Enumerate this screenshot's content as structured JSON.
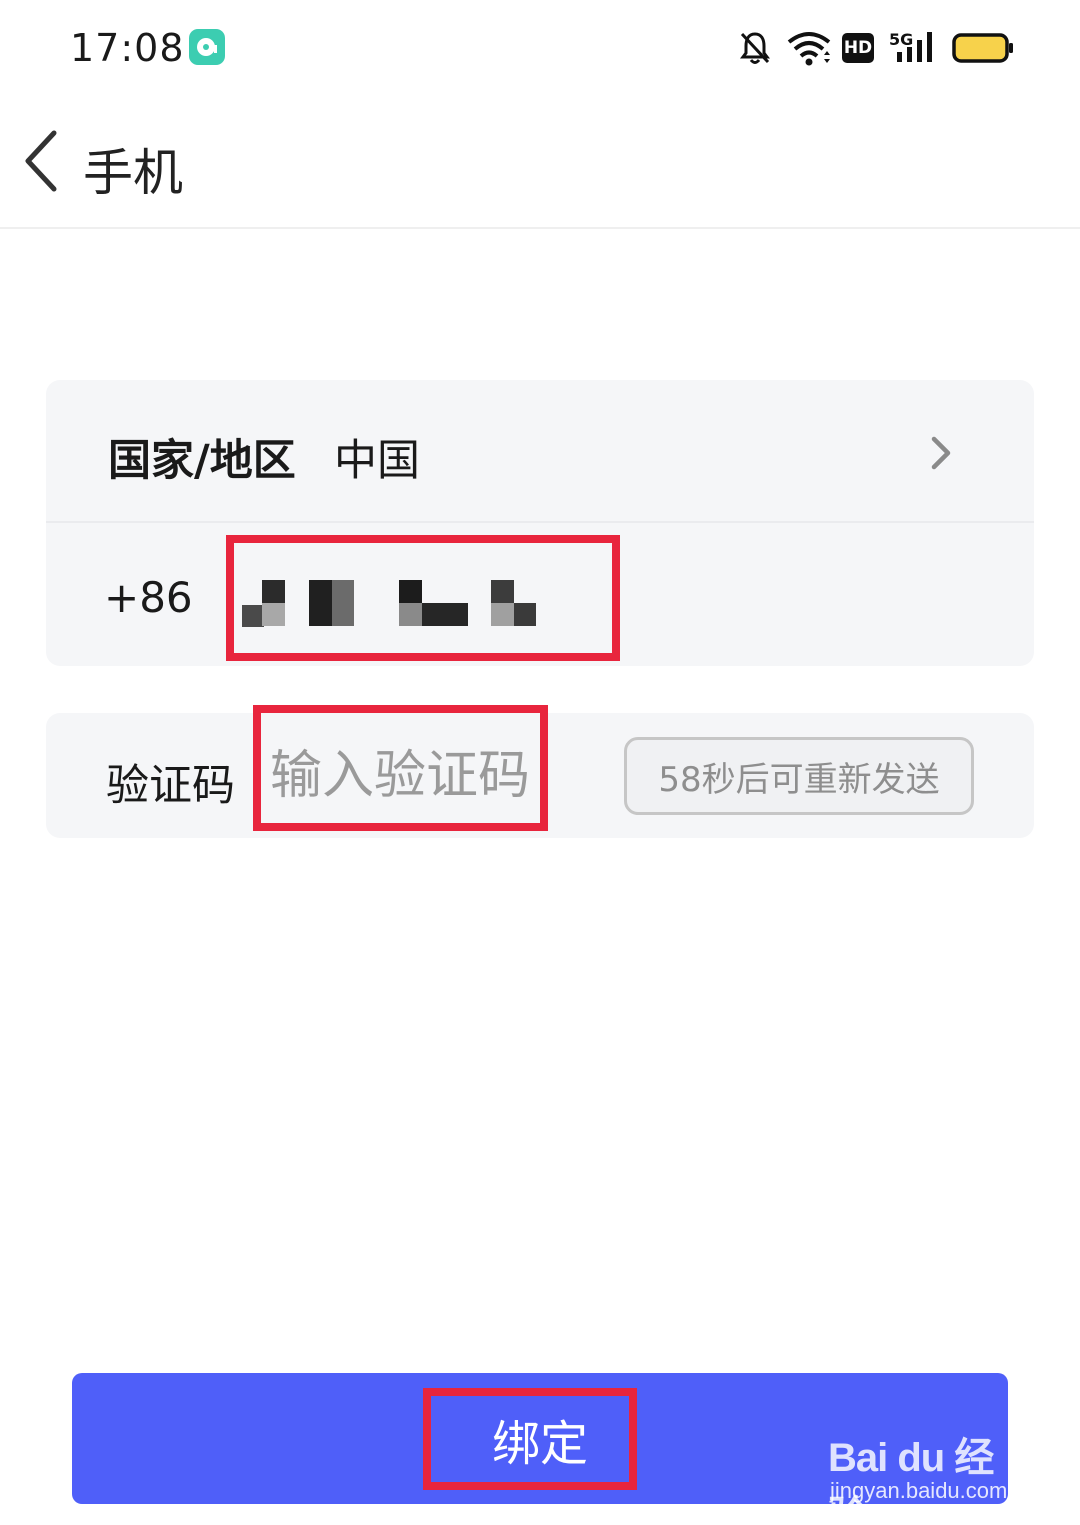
{
  "status_bar": {
    "time": "17:08",
    "icons": [
      "app-notification-icon",
      "bell-mute-icon",
      "wifi-icon",
      "hd-badge",
      "signal-5g-icon",
      "battery-icon"
    ],
    "hd_label": "HD",
    "network_label": "5G"
  },
  "header": {
    "back_icon": "chevron-left-icon",
    "title": "手机"
  },
  "form": {
    "country_label": "国家/地区",
    "country_value": "中国",
    "country_chevron": "chevron-right-icon",
    "country_code": "+86",
    "phone_number_redacted": true,
    "code_label": "验证码",
    "code_placeholder": "输入验证码",
    "code_value": "",
    "resend_label": "58秒后可重新发送"
  },
  "bind_button_label": "绑定",
  "watermark": {
    "logo_text": "Bai du 经验",
    "url": "jingyan.baidu.com"
  },
  "colors": {
    "primary": "#4f5ff9",
    "highlight": "#e8253d",
    "card_bg": "#f5f6f8",
    "placeholder": "#9a9a9a"
  }
}
